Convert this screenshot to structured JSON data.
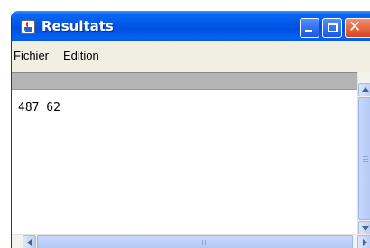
{
  "window": {
    "title": "Resultats",
    "icon": "java-cup-icon"
  },
  "titlebar_buttons": {
    "minimize_icon": "minimize-icon",
    "maximize_icon": "maximize-icon",
    "close_icon": "close-icon"
  },
  "menubar": {
    "items": [
      {
        "label": "Fichier"
      },
      {
        "label": "Edition"
      }
    ]
  },
  "content": {
    "text": "487 62"
  },
  "colors": {
    "titlebar": "#0256e5",
    "close_button": "#d9441b",
    "header_bar": "#b4b4b4",
    "scrollbar_thumb": "#b3c8f5"
  }
}
